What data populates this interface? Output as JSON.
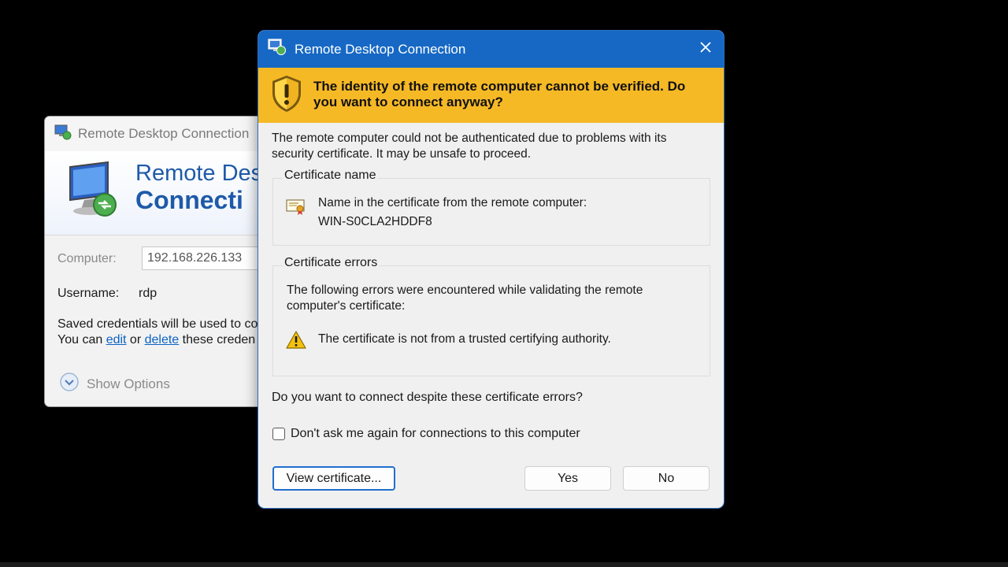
{
  "background_window": {
    "title": "Remote Desktop Connection",
    "banner_line1": "Remote Des",
    "banner_line2": "Connecti",
    "computer_label": "Computer:",
    "computer_value": "192.168.226.133",
    "username_label": "Username:",
    "username_value": "rdp",
    "saved_line1": "Saved credentials will be used to co",
    "saved_prefix": "You can ",
    "edit_link": "edit",
    "saved_or": " or ",
    "delete_link": "delete",
    "saved_suffix": " these creden",
    "show_options": "Show Options"
  },
  "dialog": {
    "title": "Remote Desktop Connection",
    "warning_heading": "The identity of the remote computer cannot be verified. Do you want to connect anyway?",
    "intro": "The remote computer could not be authenticated due to problems with its security certificate. It may be unsafe to proceed.",
    "cert_name_group": {
      "title": "Certificate name",
      "label": "Name in the certificate from the remote computer:",
      "value": "WIN-S0CLA2HDDF8"
    },
    "cert_errors_group": {
      "title": "Certificate errors",
      "intro": "The following errors were encountered while validating the remote computer's certificate:",
      "errors": [
        "The certificate is not from a trusted certifying authority."
      ]
    },
    "question": "Do you want to connect despite these certificate errors?",
    "checkbox_label": "Don't ask me again for connections to this computer",
    "checkbox_checked": false,
    "buttons": {
      "view_certificate": "View certificate...",
      "yes": "Yes",
      "no": "No"
    }
  },
  "colors": {
    "titlebar": "#1668c4",
    "warning_banner": "#f6b926",
    "link": "#0b62c4",
    "focus_border": "#1f6fcf"
  },
  "icons": [
    "rdc-app-icon",
    "rdc-monitor-icon",
    "close-icon",
    "shield-warning-icon",
    "certificate-icon",
    "warning-triangle-icon",
    "chevron-down-circle-icon"
  ]
}
